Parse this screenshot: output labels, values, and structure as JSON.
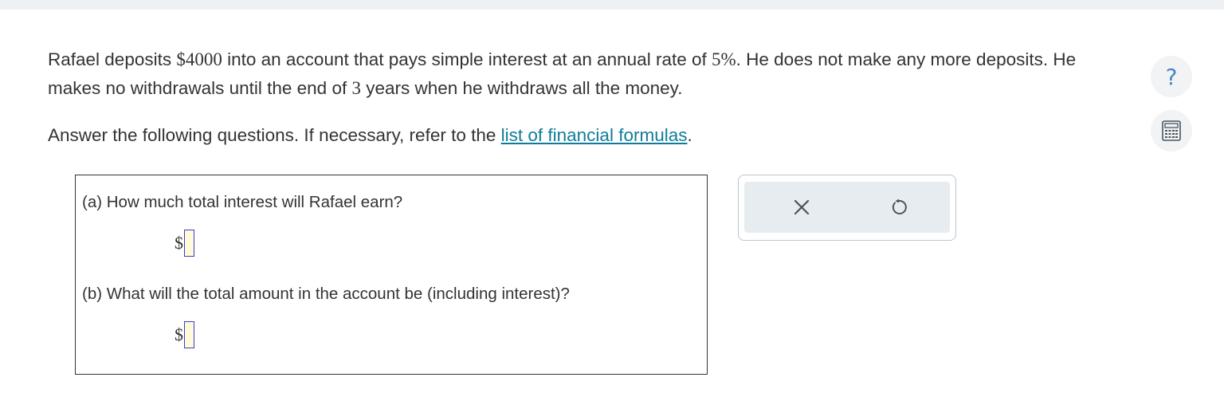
{
  "problem": {
    "part1": "Rafael deposits ",
    "deposit": "$4000",
    "part2": " into an account that pays simple interest at an annual rate of ",
    "rate": "5%",
    "part3": ". He does not make any more deposits. He makes no withdrawals until the end of ",
    "years": "3",
    "part4": " years when he withdraws all the money."
  },
  "instructions": {
    "text": "Answer the following questions. If necessary, refer to the ",
    "link_label": "list of financial formulas",
    "end": "."
  },
  "questions": [
    {
      "label": "(a) How much total interest will Rafael earn?",
      "prefix": "$",
      "value": ""
    },
    {
      "label": "(b) What will the total amount in the account be (including interest)?",
      "prefix": "$",
      "value": ""
    }
  ],
  "side_tools": {
    "help_symbol": "?",
    "help_icon": "question-mark-icon",
    "calculator_icon": "calculator-icon"
  },
  "toolbar": {
    "clear_icon": "x-icon",
    "undo_icon": "undo-icon"
  },
  "colors": {
    "link": "#0f7c99",
    "input_border": "#3b3bd6",
    "input_fill": "#fffbd9",
    "help": "#4a86c5"
  }
}
